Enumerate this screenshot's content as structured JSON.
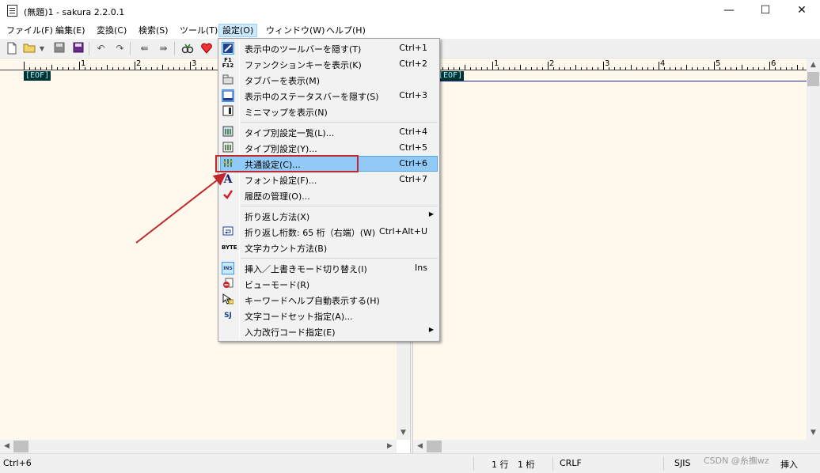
{
  "window": {
    "title": "(無題)1 - sakura 2.2.0.1",
    "icon": "notepad-icon",
    "controls": {
      "minimize": "—",
      "maximize": "☐",
      "close": "✕"
    }
  },
  "menubar": [
    "ファイル(F)",
    "編集(E)",
    "変換(C)",
    "検索(S)",
    "ツール(T)",
    "設定(O)",
    "ウィンドウ(W)",
    "ヘルプ(H)"
  ],
  "active_menu": "設定(O)",
  "toolbar": {
    "icons": [
      "new-file-icon",
      "open-folder-icon",
      "dropdown-arrow-icon",
      "save-icon",
      "save-all-icon",
      "undo-icon",
      "redo-icon",
      "jump-back-icon",
      "jump-forward-icon",
      "grep-search-icon",
      "heart-icon"
    ]
  },
  "ruler": {
    "left_labels": [
      "1",
      "2",
      "3"
    ],
    "right_labels": [
      "1",
      "2",
      "3",
      "4",
      "5",
      "6"
    ]
  },
  "editor": {
    "eof_marker": "[EOF]"
  },
  "settings_menu": {
    "items": [
      {
        "icon": "toolbar-icon",
        "label": "表示中のツールバーを隠す(T)",
        "shortcut": "Ctrl+1",
        "checked": true
      },
      {
        "icon": "function-key-icon",
        "label": "ファンクションキーを表示(K)",
        "shortcut": "Ctrl+2"
      },
      {
        "icon": "tab-bar-icon",
        "label": "タブバーを表示(M)",
        "shortcut": ""
      },
      {
        "icon": "status-bar-icon",
        "label": "表示中のステータスバーを隠す(S)",
        "shortcut": "Ctrl+3",
        "checked": true
      },
      {
        "icon": "minimap-icon",
        "label": "ミニマップを表示(N)",
        "shortcut": ""
      },
      {
        "icon": "type-settings-list-icon",
        "label": "タイプ別設定一覧(L)...",
        "shortcut": "Ctrl+4"
      },
      {
        "icon": "type-settings-icon",
        "label": "タイプ別設定(Y)...",
        "shortcut": "Ctrl+5"
      },
      {
        "icon": "common-settings-icon",
        "label": "共通設定(C)...",
        "shortcut": "Ctrl+6",
        "highlighted": true
      },
      {
        "icon": "font-icon",
        "label": "フォント設定(F)...",
        "shortcut": "Ctrl+7"
      },
      {
        "icon": "checkmark-icon",
        "label": "履歴の管理(O)...",
        "shortcut": ""
      },
      {
        "icon": "",
        "label": "折り返し方法(X)",
        "shortcut": "",
        "submenu": true
      },
      {
        "icon": "wrap-column-icon",
        "label": "折り返し桁数: 65 桁（右端）(W)",
        "shortcut": "Ctrl+Alt+U"
      },
      {
        "icon": "byte-count-icon",
        "label": "文字カウント方法(B)",
        "shortcut": ""
      },
      {
        "icon": "insert-mode-icon",
        "label": "挿入／上書きモード切り替え(I)",
        "shortcut": "Ins",
        "checked": true
      },
      {
        "icon": "view-mode-icon",
        "label": "ビューモード(R)",
        "shortcut": ""
      },
      {
        "icon": "keyword-help-icon",
        "label": "キーワードヘルプ自動表示する(H)",
        "shortcut": ""
      },
      {
        "icon": "charset-icon",
        "label": "文字コードセット指定(A)...",
        "shortcut": ""
      },
      {
        "icon": "",
        "label": "入力改行コード指定(E)",
        "shortcut": "",
        "submenu": true
      }
    ],
    "byte_icon_text": "BYTE",
    "font_icon_text": "A",
    "submenu_glyph": "▶"
  },
  "statusbar": {
    "message": "Ctrl+6",
    "line": "1 行",
    "column": "1 桁",
    "eol": "CRLF",
    "encoding": "SJIS",
    "mode": "挿入"
  },
  "watermark": "CSDN @糸撫wz",
  "colors": {
    "editor_bg": "#fef9ec",
    "eof_bg": "#003333",
    "eof_fg": "#9ff2ff",
    "highlight": "#91c9f7",
    "annotation": "#c0282d"
  }
}
